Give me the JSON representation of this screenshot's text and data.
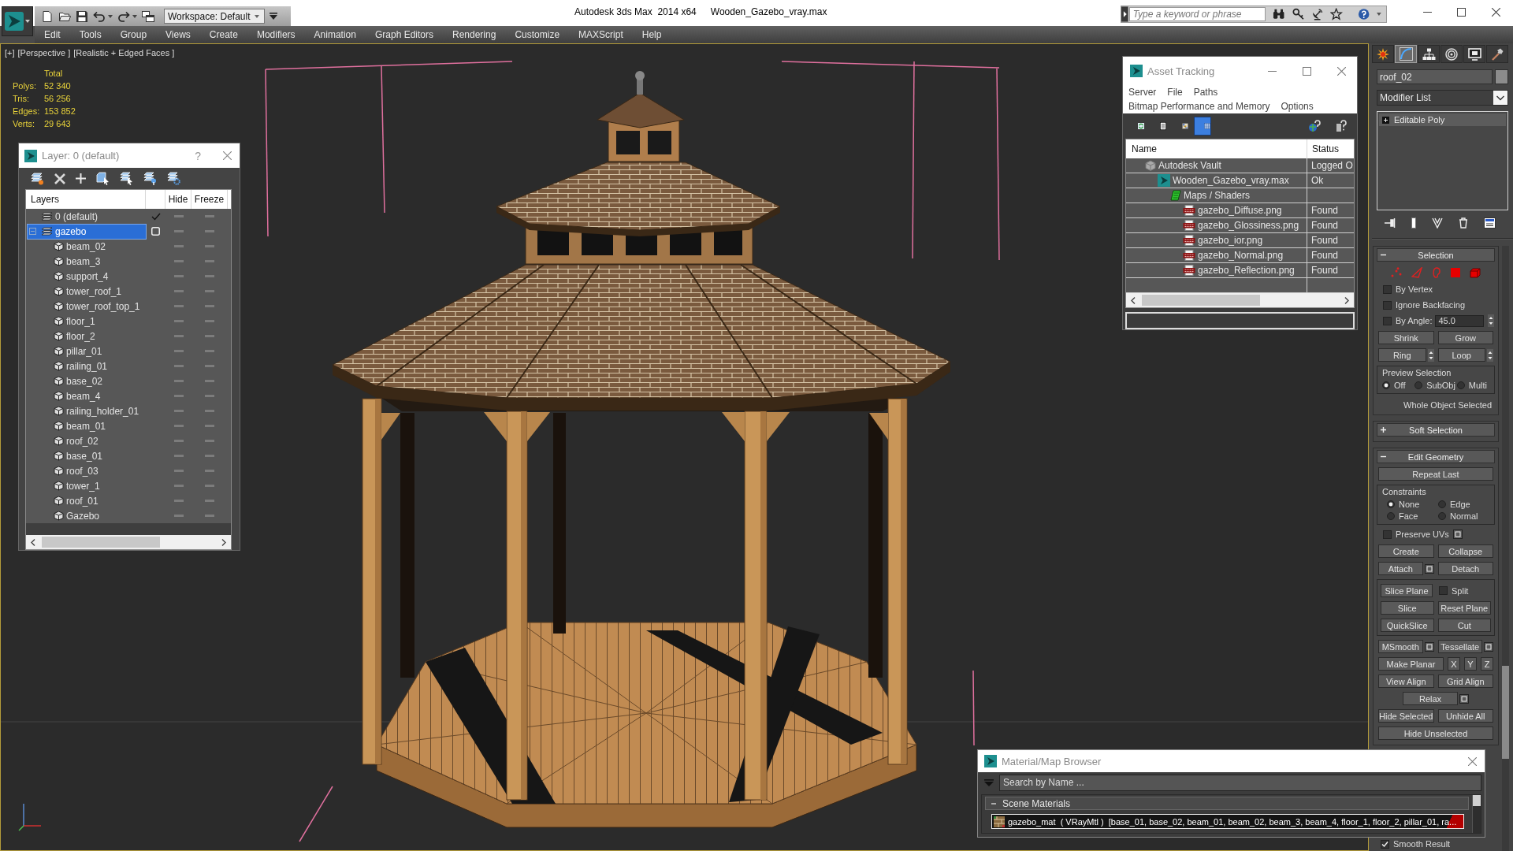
{
  "title_bar": {
    "workspace": "Workspace: Default",
    "app_title": "Autodesk 3ds Max  2014 x64",
    "file_name": "Wooden_Gazebo_vray.max",
    "search": {
      "placeholder": "Type a keyword or phrase"
    }
  },
  "menu_bar": [
    "Edit",
    "Tools",
    "Group",
    "Views",
    "Create",
    "Modifiers",
    "Animation",
    "Graph Editors",
    "Rendering",
    "Customize",
    "MAXScript",
    "Help"
  ],
  "viewport": {
    "labels": [
      "[+]",
      "[Perspective ]",
      "[Realistic + Edged Faces ]"
    ],
    "stats": {
      "header": "Total",
      "rows": [
        {
          "label": "Polys:",
          "value": "52 340"
        },
        {
          "label": "Tris:",
          "value": "56 256"
        },
        {
          "label": "Edges:",
          "value": "153 852"
        },
        {
          "label": "Verts:",
          "value": "29 643"
        }
      ]
    }
  },
  "layer_window": {
    "title": "Layer: 0 (default)",
    "help": "?",
    "columns": [
      "Layers",
      "Hide",
      "Freeze"
    ],
    "layers": [
      {
        "name": "0 (default)",
        "current": true,
        "selected": false
      },
      {
        "name": "gazebo",
        "current": false,
        "selected": true,
        "expanded": true,
        "children": [
          {
            "name": "beam_02",
            "selected": false
          },
          {
            "name": "beam_3",
            "selected": false
          },
          {
            "name": "support_4",
            "selected": false
          },
          {
            "name": "tower_roof_1",
            "selected": false
          },
          {
            "name": "tower_roof_top_1",
            "selected": false
          },
          {
            "name": "floor_1",
            "selected": false
          },
          {
            "name": "floor_2",
            "selected": false
          },
          {
            "name": "pillar_01",
            "selected": false
          },
          {
            "name": "railing_01",
            "selected": false
          },
          {
            "name": "base_02",
            "selected": false
          },
          {
            "name": "beam_4",
            "selected": false
          },
          {
            "name": "railing_holder_01",
            "selected": false
          },
          {
            "name": "beam_01",
            "selected": false
          },
          {
            "name": "roof_02",
            "selected": false
          },
          {
            "name": "base_01",
            "selected": false
          },
          {
            "name": "roof_03",
            "selected": false
          },
          {
            "name": "tower_1",
            "selected": false
          },
          {
            "name": "roof_01",
            "selected": false
          },
          {
            "name": "Gazebo",
            "selected": false
          }
        ]
      }
    ]
  },
  "asset_window": {
    "title": "Asset Tracking",
    "menu_rows": [
      [
        "Server",
        "File",
        "Paths"
      ],
      [
        "Bitmap Performance and Memory",
        "Options"
      ]
    ],
    "view_buttons": [
      {
        "selected": false
      },
      {
        "selected": false
      },
      {
        "selected": false
      },
      {
        "selected": true
      }
    ],
    "columns": [
      "Name",
      "Status"
    ],
    "rows": [
      {
        "name": "Autodesk Vault",
        "status": "Logged O",
        "kind": "vault",
        "children": [
          {
            "name": "Wooden_Gazebo_vray.max",
            "status": "Ok",
            "kind": "scene",
            "children": [
              {
                "name": "Maps / Shaders",
                "kind": "folder",
                "children": [
                  {
                    "name": "gazebo_Diffuse.png",
                    "status": "Found",
                    "kind": "image"
                  },
                  {
                    "name": "gazebo_Glossiness.png",
                    "status": "Found",
                    "kind": "image"
                  },
                  {
                    "name": "gazebo_ior.png",
                    "status": "Found",
                    "kind": "image"
                  },
                  {
                    "name": "gazebo_Normal.png",
                    "status": "Found",
                    "kind": "image"
                  },
                  {
                    "name": "gazebo_Reflection.png",
                    "status": "Found",
                    "kind": "image"
                  }
                ]
              }
            ]
          }
        ]
      }
    ]
  },
  "command_panel": {
    "tabs": [
      {
        "selected": false
      },
      {
        "selected": true
      },
      {
        "selected": false
      },
      {
        "selected": false
      },
      {
        "selected": false
      },
      {
        "selected": false
      }
    ],
    "object_name": "roof_02",
    "modifier_list": "Modifier List",
    "stack": [
      {
        "name": "Editable Poly",
        "expanded": false
      }
    ],
    "rollouts": [
      {
        "title": "Selection",
        "expanded": true,
        "blocks": [
          {
            "kind": "subobjects"
          },
          {
            "kind": "check",
            "label": "By Vertex",
            "checked": false
          },
          {
            "kind": "check",
            "label": "Ignore Backfacing",
            "checked": false
          },
          {
            "kind": "check_value",
            "label": "By Angle:",
            "checked": false,
            "value": "45.0"
          },
          {
            "kind": "buttons",
            "items": [
              {
                "kind": "button",
                "label": "Shrink"
              },
              {
                "kind": "button",
                "label": "Grow"
              }
            ]
          },
          {
            "kind": "buttons",
            "items": [
              {
                "kind": "button",
                "label": "Ring",
                "spinner": true
              },
              {
                "kind": "button",
                "label": "Loop",
                "spinner": true
              }
            ]
          },
          {
            "kind": "radio_group",
            "title": "Preview Selection",
            "options": [
              {
                "label": "Off",
                "selected": true
              },
              {
                "label": "SubObj",
                "selected": false
              },
              {
                "label": "Multi",
                "selected": false
              }
            ]
          },
          {
            "kind": "note",
            "text": "Whole Object Selected"
          }
        ]
      },
      {
        "title": "Soft Selection",
        "expanded": false
      },
      {
        "title": "Edit Geometry",
        "expanded": true,
        "blocks": [
          {
            "kind": "buttons",
            "items": [
              {
                "kind": "button",
                "label": "Repeat Last"
              }
            ]
          },
          {
            "kind": "radio_group",
            "title": "Constraints",
            "options": [
              {
                "label": "None",
                "selected": true
              },
              {
                "label": "Edge",
                "selected": false
              },
              {
                "label": "Face",
                "selected": false
              },
              {
                "label": "Normal",
                "selected": false
              }
            ]
          },
          {
            "kind": "check",
            "label": "Preserve UVs",
            "checked": false,
            "options": true
          },
          {
            "kind": "buttons",
            "items": [
              {
                "kind": "button",
                "label": "Create"
              },
              {
                "kind": "button",
                "label": "Collapse"
              }
            ]
          },
          {
            "kind": "buttons",
            "items": [
              {
                "kind": "button",
                "label": "Attach",
                "options": true
              },
              {
                "kind": "button",
                "label": "Detach"
              }
            ]
          },
          {
            "kind": "group",
            "rows": [
              [
                {
                  "kind": "button",
                  "label": "Slice Plane"
                },
                {
                  "kind": "check",
                  "label": "Split",
                  "checked": false
                }
              ],
              [
                {
                  "kind": "button",
                  "label": "Slice"
                },
                {
                  "kind": "button",
                  "label": "Reset Plane"
                }
              ],
              [
                {
                  "kind": "button",
                  "label": "QuickSlice"
                },
                {
                  "kind": "button",
                  "label": "Cut"
                }
              ]
            ]
          },
          {
            "kind": "buttons",
            "items": [
              {
                "kind": "button",
                "label": "MSmooth",
                "options": true
              },
              {
                "kind": "button",
                "label": "Tessellate",
                "options": true
              }
            ]
          },
          {
            "kind": "buttons",
            "items": [
              {
                "kind": "button",
                "label": "Make Planar"
              },
              {
                "kind": "small",
                "label": "X"
              },
              {
                "kind": "small",
                "label": "Y"
              },
              {
                "kind": "small",
                "label": "Z"
              }
            ]
          },
          {
            "kind": "buttons",
            "items": [
              {
                "kind": "button",
                "label": "View Align"
              },
              {
                "kind": "button",
                "label": "Grid Align"
              }
            ]
          },
          {
            "kind": "buttons",
            "items": [
              {
                "kind": "button",
                "label": "Relax",
                "options": true
              }
            ]
          },
          {
            "kind": "buttons",
            "items": [
              {
                "kind": "button",
                "label": "Hide Selected"
              },
              {
                "kind": "button",
                "label": "Unhide All"
              }
            ]
          },
          {
            "kind": "buttons",
            "items": [
              {
                "kind": "button",
                "label": "Hide Unselected"
              }
            ]
          }
        ]
      }
    ],
    "footer_check": {
      "label": "Smooth Result",
      "checked": true
    }
  },
  "material_browser": {
    "title": "Material/Map Browser",
    "search": {
      "placeholder": "Search by Name ..."
    },
    "groups": [
      {
        "title": "Scene Materials",
        "expanded": true,
        "items": [
          {
            "label": "gazebo_mat  ( VRayMtl )  [base_01, base_02, beam_01, beam_02, beam_3, beam_4, floor_1, floor_2, pillar_01, ra..."
          }
        ]
      }
    ]
  }
}
